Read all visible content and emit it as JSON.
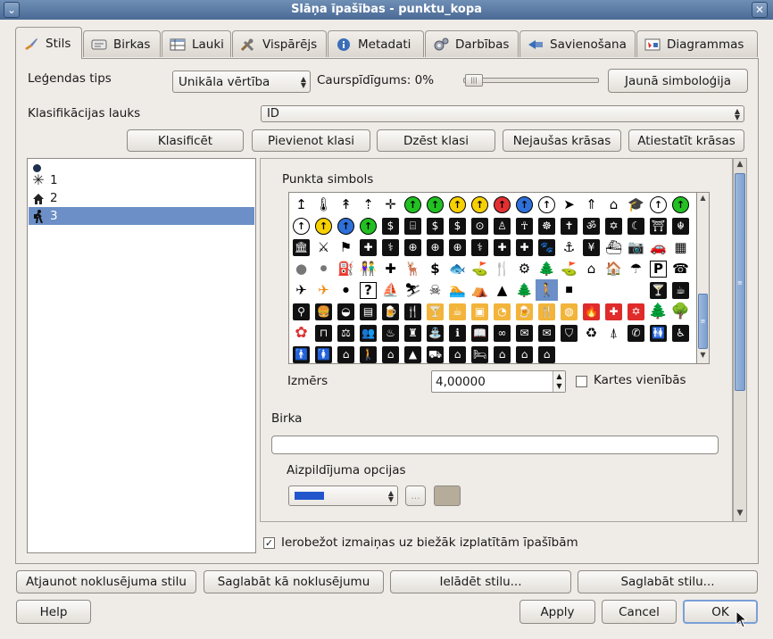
{
  "window": {
    "title": "Slāņa īpašības - punktu_kopa",
    "menu_glyph": "⌄",
    "close_glyph": "✕"
  },
  "tabs": [
    {
      "label": "Stils",
      "icon": "brush-icon"
    },
    {
      "label": "Birkas",
      "icon": "label-icon"
    },
    {
      "label": "Lauki",
      "icon": "table-icon"
    },
    {
      "label": "Vispārējs",
      "icon": "tools-icon"
    },
    {
      "label": "Metadati",
      "icon": "info-icon"
    },
    {
      "label": "Darbības",
      "icon": "gears-icon"
    },
    {
      "label": "Savienošana",
      "icon": "join-icon"
    },
    {
      "label": "Diagrammas",
      "icon": "diagram-icon"
    }
  ],
  "style": {
    "legend_type_label": "Leģendas tips",
    "legend_type_value": "Unikāla vērtība",
    "transparency_label": "Caurspīdīgums: 0%",
    "transparency_value": 0,
    "new_symbology_button": "Jaunā simboloģija",
    "classification_field_label": "Klasifikācijas lauks",
    "classification_field_value": "ID",
    "buttons": {
      "classify": "Klasificēt",
      "add_class": "Pievienot klasi",
      "delete_class": "Dzēst klasi",
      "random_colors": "Nejaušas krāsas",
      "reset_colors": "Atiestatīt krāsas"
    },
    "classes": [
      {
        "label": "",
        "icon": "dot-icon"
      },
      {
        "label": "1",
        "icon": "asterisk-icon"
      },
      {
        "label": "2",
        "icon": "house-icon"
      },
      {
        "label": "3",
        "icon": "hiker-icon",
        "selected": true
      }
    ],
    "point_symbol_label": "Punkta simbols",
    "size_label": "Izmērs",
    "size_value": "4,00000",
    "map_units_label": "Kartes vienībās",
    "map_units_checked": false,
    "label_section": "Birka",
    "label_value": "",
    "fill_options_label": "Aizpildījuma opcijas",
    "fill_color": "#2255cc",
    "more_button": "...",
    "swatch_color": "#b5ad9a",
    "restrict_checkbox_label": "Ierobežot izmaiņas uz biežāk izplatītām īpašībām",
    "restrict_checked": true
  },
  "bottom_buttons": {
    "restore_default": "Atjaunot noklusējuma stilu",
    "save_as_default": "Saglabāt kā noklusējumu",
    "load_style": "Ielādēt stilu...",
    "save_style": "Saglabāt stilu..."
  },
  "footer": {
    "help": "Help",
    "apply": "Apply",
    "cancel": "Cancel",
    "ok": "OK"
  }
}
